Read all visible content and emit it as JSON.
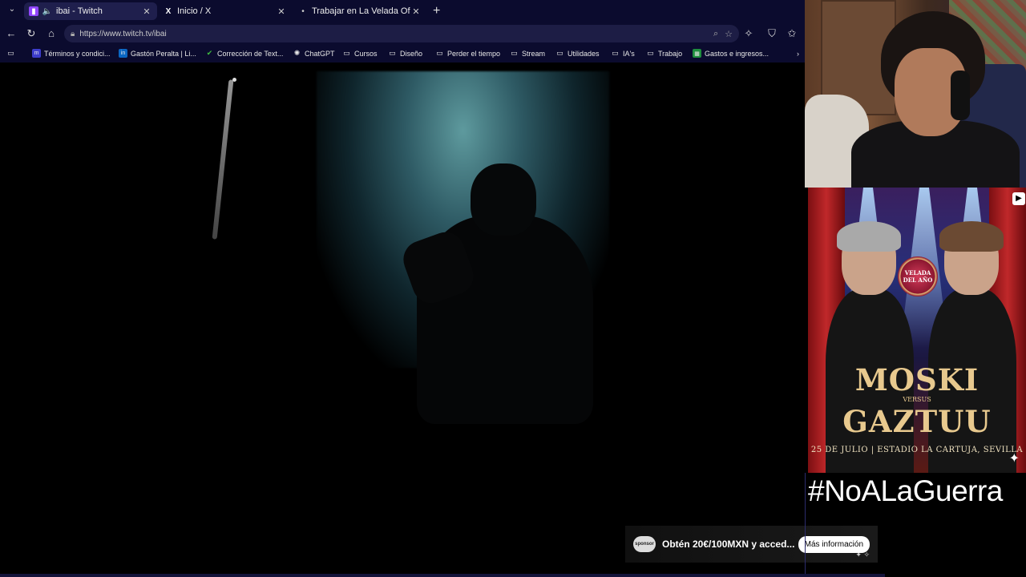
{
  "tabs": [
    {
      "label": "ibai - Twitch",
      "icon": "twitch-icon",
      "active": true
    },
    {
      "label": "Inicio / X",
      "icon": "x-icon",
      "active": false
    },
    {
      "label": "Trabajar en La Velada Ofertas de e",
      "icon": "dot-icon",
      "active": false
    }
  ],
  "navbar": {
    "url": "https://www.twitch.tv/ibai"
  },
  "bookmarks": [
    {
      "label": "Términos y condici...",
      "icon": "m-icon"
    },
    {
      "label": "Gastón Peralta | Li...",
      "icon": "linkedin-icon"
    },
    {
      "label": "Corrección de Text...",
      "icon": "check-icon"
    },
    {
      "label": "ChatGPT",
      "icon": "chatgpt-icon"
    },
    {
      "label": "Cursos",
      "icon": "folder-icon"
    },
    {
      "label": "Diseño",
      "icon": "folder-icon"
    },
    {
      "label": "Perder el tiempo",
      "icon": "folder-icon"
    },
    {
      "label": "Stream",
      "icon": "folder-icon"
    },
    {
      "label": "Utilidades",
      "icon": "folder-icon"
    },
    {
      "label": "IA's",
      "icon": "folder-icon"
    },
    {
      "label": "Trabajo",
      "icon": "folder-icon"
    },
    {
      "label": "Gastos e ingresos...",
      "icon": "sheets-icon"
    }
  ],
  "poster": {
    "badge": "VELADA DEL AÑO",
    "fighter1": "MOSKI",
    "versus": "VERSUS",
    "fighter2": "GAZTUU",
    "date_location": "25 DE JULIO | ESTADIO LA CARTUJA, SEVILLA"
  },
  "overlay": {
    "hashtag": "#NoALaGuerra"
  },
  "ad": {
    "logo": "sponsor",
    "text": "Obtén 20€/100MXN y acced...",
    "button": "Más información"
  }
}
